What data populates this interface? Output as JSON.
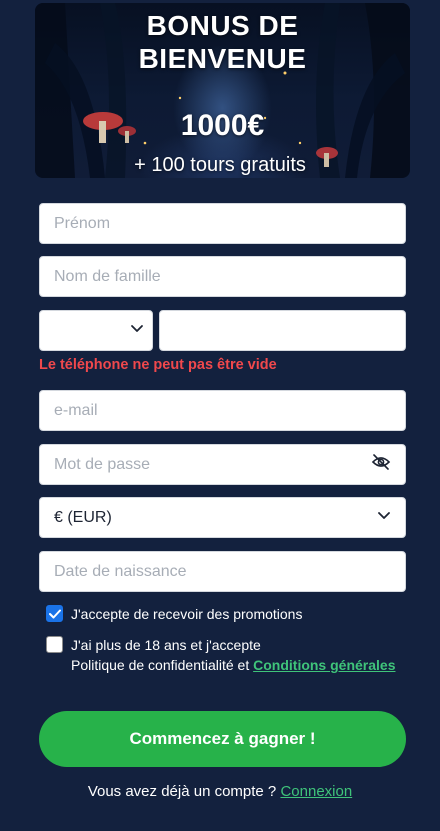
{
  "banner": {
    "title_line1": "BONUS DE",
    "title_line2": "BIENVENUE",
    "amount": "1000€",
    "subtitle": "+ 100 tours gratuits"
  },
  "form": {
    "first_name": {
      "placeholder": "Prénom"
    },
    "last_name": {
      "placeholder": "Nom de famille"
    },
    "phone": {
      "prefix_icon": "chevron-down-icon",
      "error": "Le téléphone ne peut pas être vide"
    },
    "email": {
      "placeholder": "e-mail"
    },
    "password": {
      "placeholder": "Mot de passe",
      "toggle_icon": "eye-slash-icon"
    },
    "currency": {
      "value": "€ (EUR)",
      "icon": "chevron-down-icon"
    },
    "birthdate": {
      "placeholder": "Date de naissance"
    },
    "promotions": {
      "checked": true,
      "label": "J'accepte de recevoir des promotions"
    },
    "terms": {
      "checked": false,
      "label_line1": "J'ai plus de 18 ans et j'accepte",
      "label_line2": "Politique de confidentialité et ",
      "link": "Conditions générales"
    },
    "submit_label": "Commencez à gagner !"
  },
  "footer": {
    "question": "Vous avez déjà un compte ? ",
    "login_link": "Connexion"
  },
  "colors": {
    "background": "#13213e",
    "accent_green": "#27b24a",
    "link_green": "#3fc47a",
    "error_red": "#f0484c",
    "checkbox_blue": "#1a73e8"
  }
}
